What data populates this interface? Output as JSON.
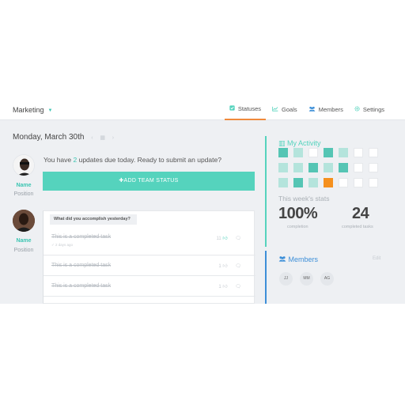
{
  "header": {
    "team_name": "Marketing",
    "tabs": [
      {
        "label": "Statuses",
        "icon": "check-icon"
      },
      {
        "label": "Goals",
        "icon": "chart-icon"
      },
      {
        "label": "Members",
        "icon": "users-icon"
      },
      {
        "label": "Settings",
        "icon": "gear-icon"
      }
    ],
    "active_tab": "Statuses"
  },
  "date": "Monday, March 30th",
  "current_user": {
    "name": "Name",
    "position": "Position"
  },
  "update_prompt": {
    "before": "You have ",
    "count": "2",
    "after": " updates due today. Ready to submit an update?"
  },
  "add_button_label": "ADD TEAM STATUS",
  "teammate": {
    "name": "Name",
    "position": "Position"
  },
  "question": "What did you accomplish yesterday?",
  "tasks": [
    {
      "text": "This is a completed task",
      "sub": "✓ 2 days ago",
      "likes": "11",
      "comments": ""
    },
    {
      "text": "This is a completed task",
      "sub": "",
      "likes": "1",
      "comments": ""
    },
    {
      "text": "This is a completed task",
      "sub": "",
      "likes": "1",
      "comments": ""
    }
  ],
  "activity": {
    "title": "My Activity",
    "cells": [
      [
        "teal",
        "light",
        "white",
        "teal",
        "light",
        "white",
        "white"
      ],
      [
        "light",
        "light",
        "teal",
        "light",
        "teal",
        "white",
        "white"
      ],
      [
        "light",
        "teal",
        "light",
        "orange",
        "white",
        "white",
        "white"
      ]
    ]
  },
  "stats": {
    "title": "This week's stats",
    "completion_value": "100%",
    "completion_label": "completion",
    "tasks_value": "24",
    "tasks_label": "completed tasks"
  },
  "members": {
    "title": "Members",
    "edit_label": "Edit",
    "initials": [
      "JJ",
      "MM",
      "AG"
    ]
  },
  "colors": {
    "accent": "#55d3bd",
    "active_tab": "#f08a3c",
    "members": "#3d8fd8",
    "orange": "#f5901e"
  }
}
